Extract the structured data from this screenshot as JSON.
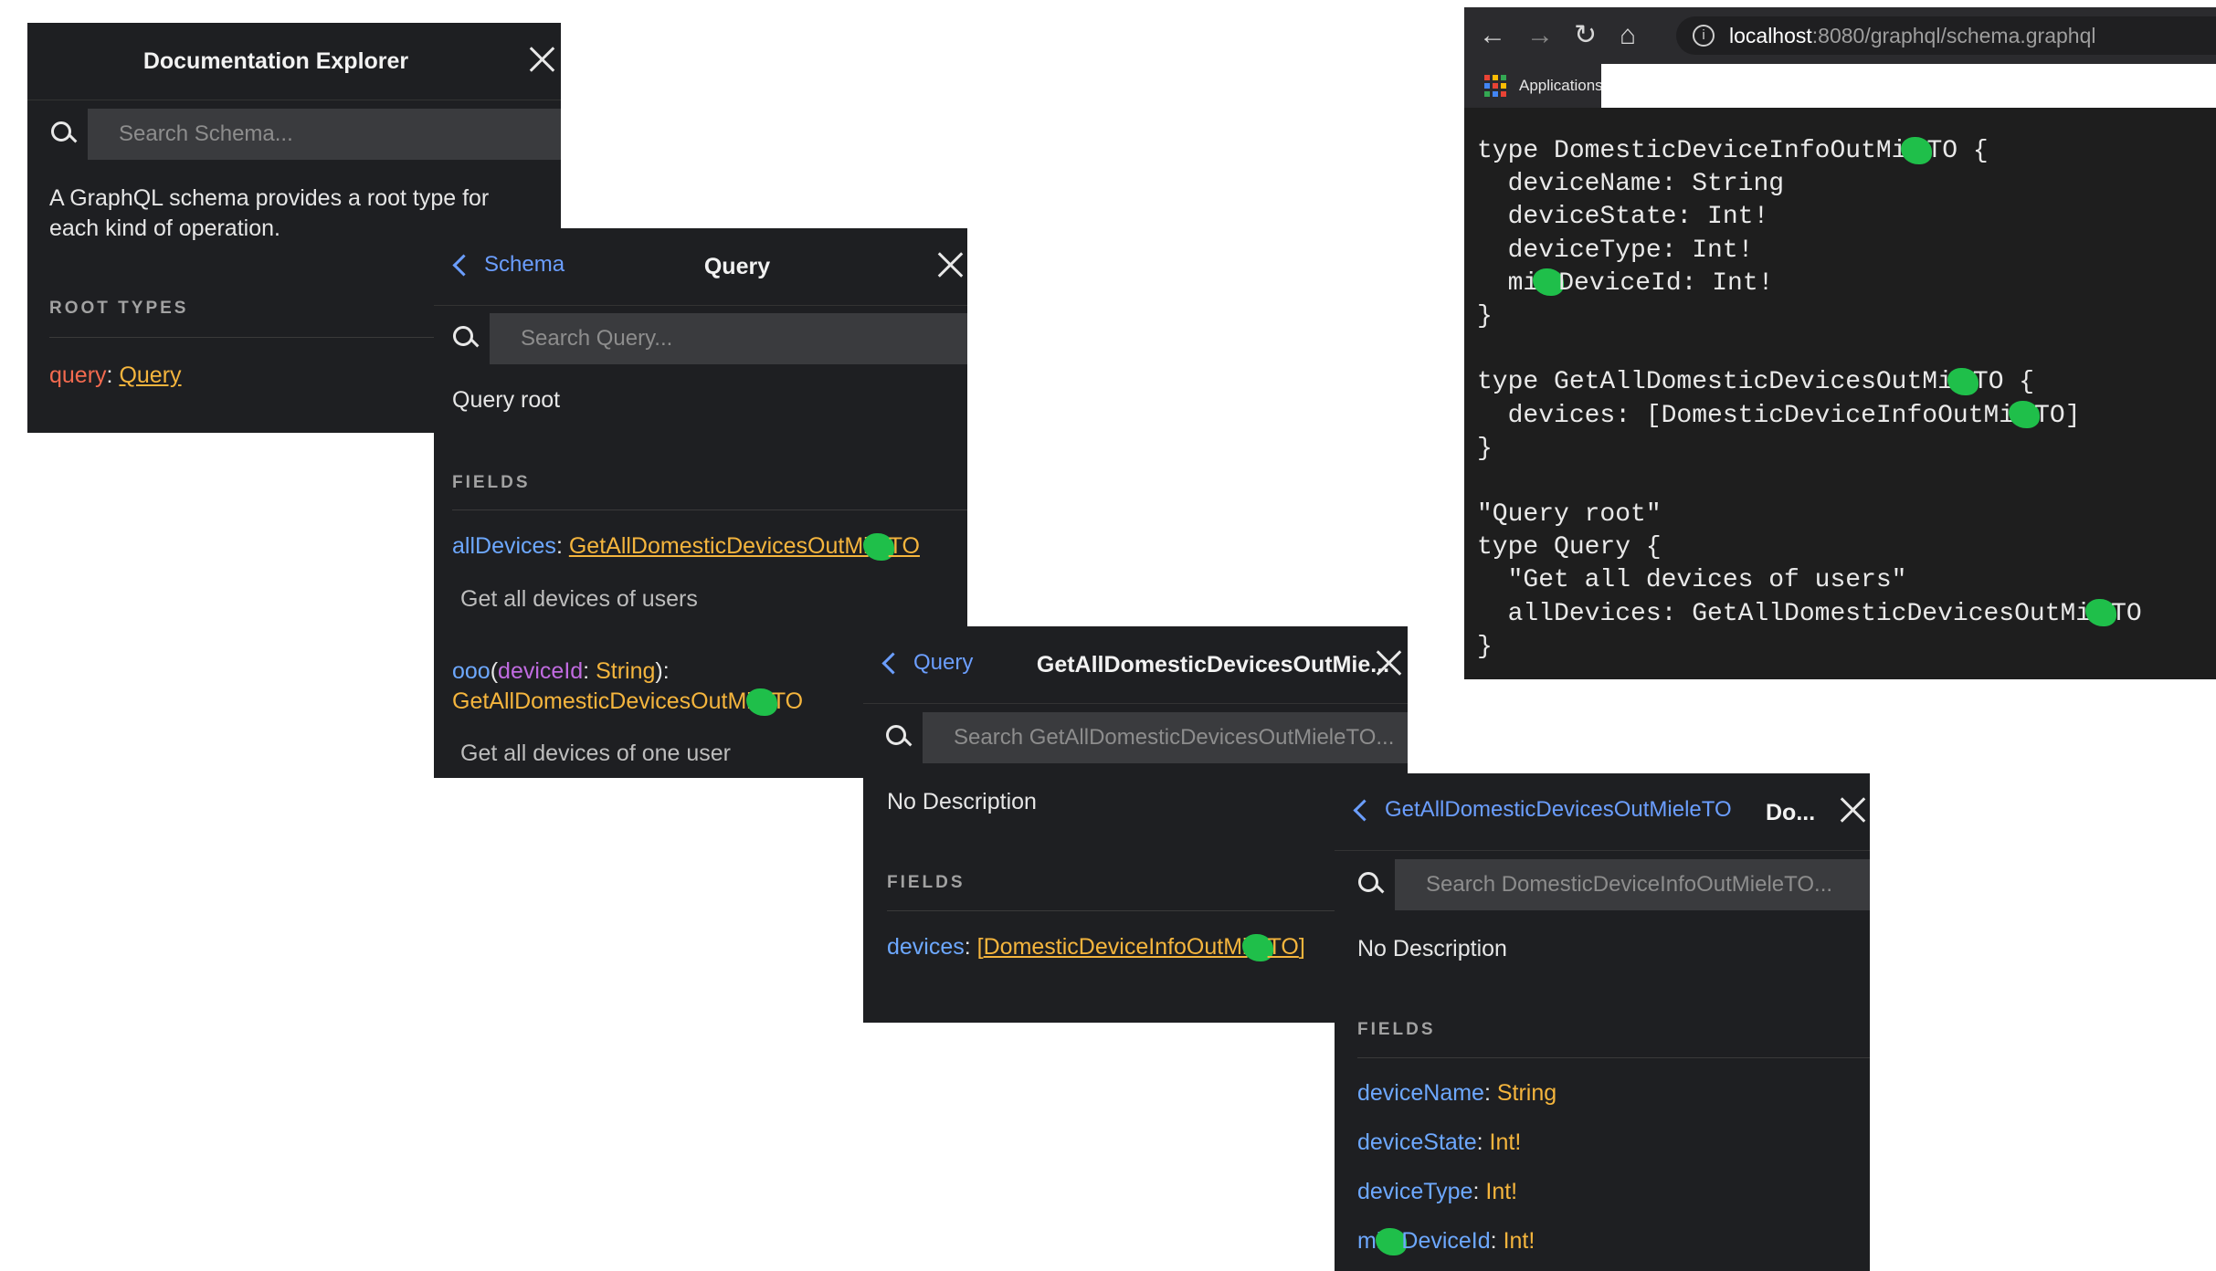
{
  "panel1": {
    "title": "Documentation Explorer",
    "search_placeholder": "Search Schema...",
    "description": "A GraphQL schema provides a root type for each kind of operation.",
    "section": "ROOT TYPES",
    "root_key": "query",
    "root_type": "Query"
  },
  "panel2": {
    "back_label": "Schema",
    "title": "Query",
    "search_placeholder": "Search Query...",
    "description": "Query root",
    "section": "FIELDS",
    "field1_name": "allDevices",
    "field1_type_a": "GetAllDomesticDevicesOutMi",
    "field1_type_b": "TO",
    "field1_desc": "Get all devices of users",
    "field2_name": "ooo",
    "field2_arg": "deviceId",
    "field2_arg_type": "String",
    "field2_type_a": "GetAllDomesticDevicesOutMi",
    "field2_type_b": "TO",
    "field2_desc": "Get all devices of one user"
  },
  "panel3": {
    "back_label": "Query",
    "title": "GetAllDomesticDevicesOutMie...",
    "search_placeholder": "Search GetAllDomesticDevicesOutMieleTO...",
    "description": "No Description",
    "section": "FIELDS",
    "field_name": "devices",
    "field_type_a": "DomesticDeviceInfoOutMi",
    "field_type_b": "TO"
  },
  "panel4": {
    "back_label": "GetAllDomesticDevicesOutMieleTO",
    "title": "Do...",
    "search_placeholder": "Search DomesticDeviceInfoOutMieleTO...",
    "description": "No Description",
    "section": "FIELDS",
    "fields": [
      {
        "name": "deviceName",
        "type": "String"
      },
      {
        "name": "deviceState",
        "type": "Int!"
      },
      {
        "name": "deviceType",
        "type": "Int!"
      },
      {
        "name_a": "mi",
        "name_b": "DeviceId",
        "type": "Int!"
      }
    ]
  },
  "browser": {
    "url_host": "localhost",
    "url_rest": ":8080/graphql/schema.graphql",
    "bookmark": "Applications",
    "code_lines": [
      [
        "type DomesticDeviceInfoOutMi",
        "TO {"
      ],
      [
        "  deviceName: String"
      ],
      [
        "  deviceState: Int!"
      ],
      [
        "  deviceType: Int!"
      ],
      [
        "  mi",
        "DeviceId: Int!"
      ],
      [
        "}"
      ],
      [
        ""
      ],
      [
        "type GetAllDomesticDevicesOutMi",
        "TO {"
      ],
      [
        "  devices: [DomesticDeviceInfoOutMi",
        "TO]"
      ],
      [
        "}"
      ],
      [
        ""
      ],
      [
        "\"Query root\""
      ],
      [
        "type Query {"
      ],
      [
        "  \"Get all devices of users\""
      ],
      [
        "  allDevices: GetAllDomesticDevicesOutMi",
        "TO"
      ],
      [
        "}"
      ]
    ]
  }
}
